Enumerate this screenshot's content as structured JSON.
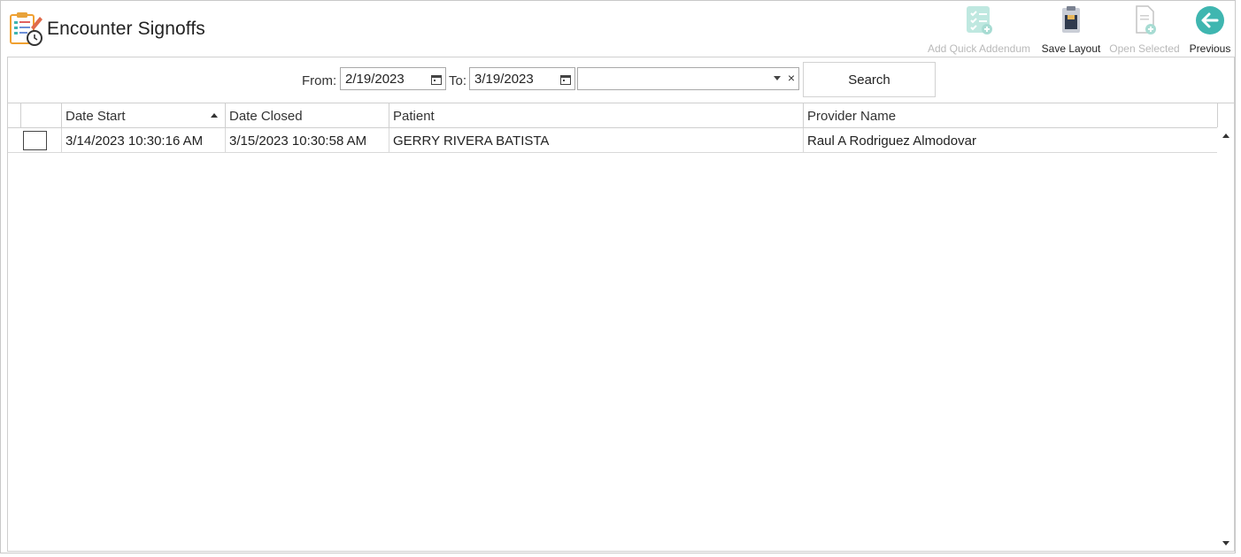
{
  "app": {
    "title": "Encounter Signoffs",
    "icon": "clipboard-clock-icon"
  },
  "toolbar": {
    "add_quick_addendum": {
      "label": "Add Quick Addendum",
      "icon": "checklist-add-icon",
      "enabled": false
    },
    "save_layout": {
      "label": "Save Layout",
      "icon": "clipboard-save-icon",
      "enabled": true
    },
    "open_selected": {
      "label": "Open Selected",
      "icon": "document-add-icon",
      "enabled": false
    },
    "previous": {
      "label": "Previous",
      "icon": "arrow-left-circle-icon",
      "enabled": true
    }
  },
  "filters": {
    "from_label": "From:",
    "from_value": "2/19/2023",
    "to_label": "To:",
    "to_value": "3/19/2023",
    "combo_value": "",
    "clear_glyph": "×",
    "search_label": "Search"
  },
  "grid": {
    "columns": [
      "Date Start",
      "Date Closed",
      "Patient",
      "Provider Name"
    ],
    "sorted_column": "Date Start",
    "sort_direction": "ascending",
    "rows": [
      {
        "checked": false,
        "date_start": "3/14/2023 10:30:16 AM",
        "date_closed": "3/15/2023 10:30:58 AM",
        "patient": "GERRY RIVERA BATISTA",
        "provider": "Raul A Rodriguez Almodovar"
      }
    ]
  },
  "colors": {
    "accent_teal": "#3fb6b0",
    "disabled_icon": "#a8dcd3",
    "border": "#cfcfcf"
  }
}
